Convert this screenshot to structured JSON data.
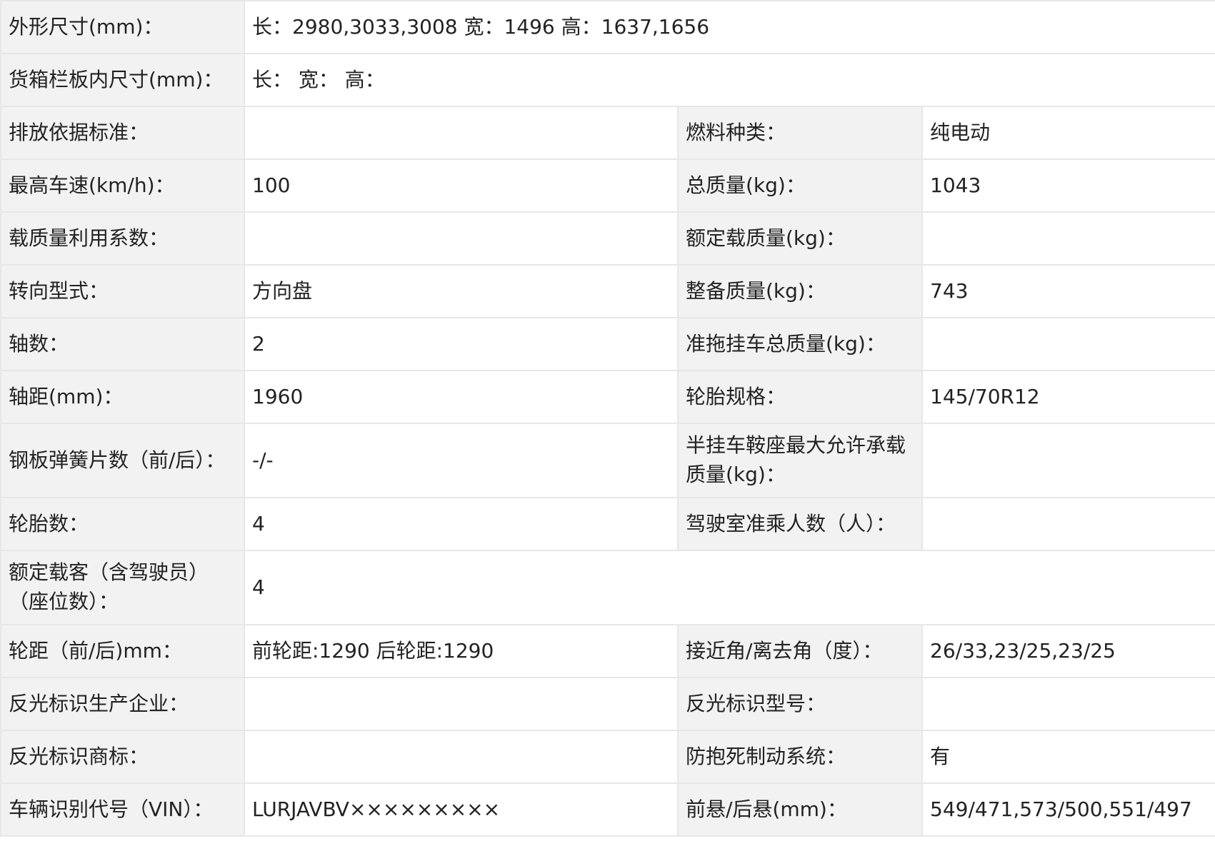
{
  "rows": [
    {
      "label": "外形尺寸(mm)：",
      "value": "长：2980,3033,3008 宽：1496 高：1637,1656"
    },
    {
      "label": "货箱栏板内尺寸(mm)：",
      "value": "长： 宽： 高："
    },
    {
      "label": "排放依据标准：",
      "value": "",
      "label2": "燃料种类：",
      "value2": "纯电动"
    },
    {
      "label": "最高车速(km/h)：",
      "value": "100",
      "label2": "总质量(kg)：",
      "value2": "1043"
    },
    {
      "label": "载质量利用系数：",
      "value": "",
      "label2": "额定载质量(kg)：",
      "value2": ""
    },
    {
      "label": "转向型式：",
      "value": "方向盘",
      "label2": "整备质量(kg)：",
      "value2": "743"
    },
    {
      "label": "轴数：",
      "value": "2",
      "label2": "准拖挂车总质量(kg)：",
      "value2": ""
    },
    {
      "label": "轴距(mm)：",
      "value": "1960",
      "label2": "轮胎规格：",
      "value2": "145/70R12"
    },
    {
      "label": "钢板弹簧片数（前/后）：",
      "value": "-/-",
      "label2": "半挂车鞍座最大允许承载质量(kg)：",
      "value2": ""
    },
    {
      "label": "轮胎数：",
      "value": "4",
      "label2": "驾驶室准乘人数（人）：",
      "value2": ""
    },
    {
      "label": "额定载客（含驾驶员）（座位数）：",
      "value": "4"
    },
    {
      "label": "轮距（前/后)mm：",
      "value": "前轮距:1290 后轮距:1290",
      "label2": "接近角/离去角（度）：",
      "value2": "26/33,23/25,23/25"
    },
    {
      "label": "反光标识生产企业：",
      "value": "",
      "label2": "反光标识型号：",
      "value2": ""
    },
    {
      "label": "反光标识商标：",
      "value": "",
      "label2": "防抱死制动系统：",
      "value2": "有"
    },
    {
      "label": "车辆识别代号（VIN）：",
      "value": "LURJAVBV×××××××××",
      "label2": "前悬/后悬(mm)：",
      "value2": "549/471,573/500,551/497"
    }
  ]
}
